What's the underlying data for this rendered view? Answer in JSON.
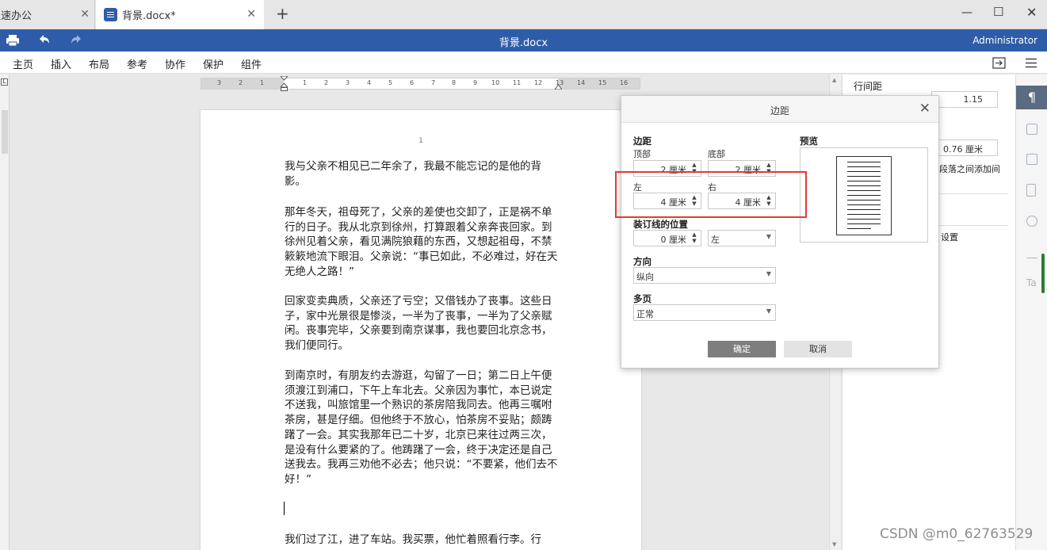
{
  "tabs": [
    {
      "label": "极速办公"
    },
    {
      "label": "背景.docx*"
    }
  ],
  "title_bar": {
    "title": "背景.docx",
    "user": "Administrator"
  },
  "menu": [
    "主页",
    "插入",
    "布局",
    "参考",
    "协作",
    "保护",
    "组件"
  ],
  "ruler": {
    "marks": [
      "3",
      "2",
      "1",
      "1",
      "2",
      "3",
      "4",
      "5",
      "6",
      "7",
      "8",
      "9",
      "10",
      "11",
      "12",
      "13",
      "14",
      "15",
      "16"
    ]
  },
  "document": {
    "page_number": "1",
    "paragraphs": [
      "我与父亲不相见已二年余了，我最不能忘记的是他的背影。",
      "那年冬天，祖母死了，父亲的差使也交卸了，正是祸不单行的日子。我从北京到徐州，打算跟着父亲奔丧回家。到徐州见着父亲，看见满院狼藉的东西，又想起祖母，不禁簌簌地流下眼泪。父亲说：“事已如此，不必难过，好在天无绝人之路！”",
      "回家变卖典质，父亲还了亏空；又借钱办了丧事。这些日子，家中光景很是惨淡，一半为了丧事，一半为了父亲赋闲。丧事完毕，父亲要到南京谋事，我也要回北京念书，我们便同行。",
      "到南京时，有朋友约去游逛，勾留了一日；第二日上午便须渡江到浦口，下午上车北去。父亲因为事忙，本已说定不送我，叫旅馆里一个熟识的茶房陪我同去。他再三嘱咐茶房，甚是仔细。但他终于不放心，怕茶房不妥贴；颇踌躇了一会。其实我那年已二十岁，北京已来往过两三次，是没有什么要紧的了。他踌躇了一会，终于决定还是自己送我去。我再三劝他不必去；他只说：“不要紧，他们去不好！”",
      "我们过了江，进了车站。我买票，他忙着照看行李。行"
    ]
  },
  "right_panel": {
    "line_spacing_label": "行间距",
    "line_spacing_value": "1.15",
    "spacing_value": "0.76 厘米",
    "add_between_text": "段落之间添加间",
    "settings_text": "设置"
  },
  "dialog": {
    "title": "边距",
    "margins_label": "边距",
    "top_label": "顶部",
    "top_value": "2 厘米",
    "bottom_label": "底部",
    "bottom_value": "2 厘米",
    "left_label": "左",
    "left_value": "4 厘米",
    "right_label": "右",
    "right_value": "4 厘米",
    "gutter_label": "装订线的位置",
    "gutter_value": "0 厘米",
    "gutter_side": "左",
    "orientation_label": "方向",
    "orientation_value": "纵向",
    "multipage_label": "多页",
    "multipage_value": "正常",
    "preview_label": "预览",
    "ok": "确定",
    "cancel": "取消"
  },
  "watermark": "CSDN @m0_62763529",
  "colors": {
    "title_bar": "#2f5ca8",
    "highlight_box": "#e53935",
    "ok_button": "#7e7e7e"
  }
}
